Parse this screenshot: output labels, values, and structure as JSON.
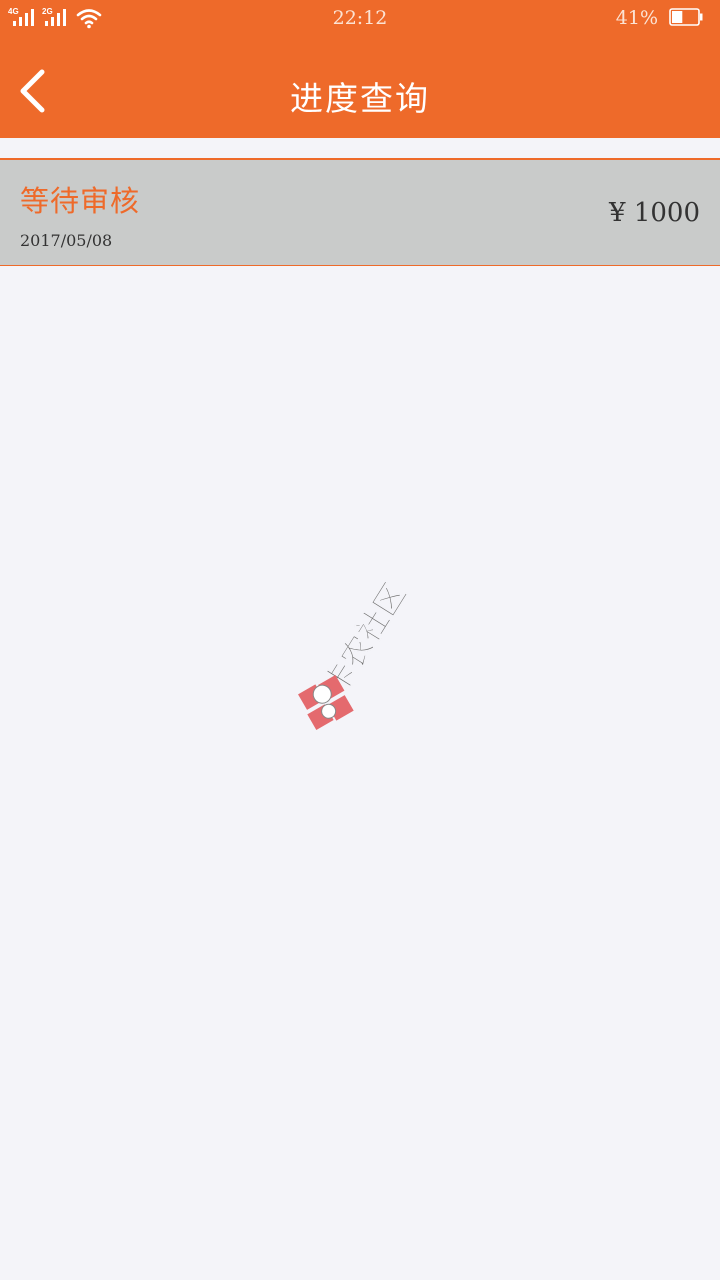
{
  "status_bar": {
    "network_1": "4G",
    "network_2": "2G",
    "time": "22:12",
    "battery_percent": "41%",
    "battery_level": 0.41
  },
  "nav": {
    "title": "进度查询",
    "back_icon": "chevron-left-icon"
  },
  "records": [
    {
      "status": "等待审核",
      "date": "2017/05/08",
      "amount": "¥ 1000"
    }
  ],
  "watermark": {
    "text": "卡农社区"
  },
  "colors": {
    "accent": "#ee6a2a",
    "row_background": "#c9cbca",
    "page_background": "#f4f4f9"
  }
}
